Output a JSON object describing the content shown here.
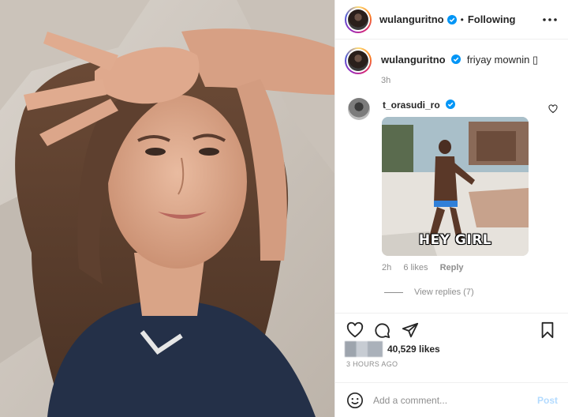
{
  "post": {
    "author": "wulanguritno",
    "follow_status": "Following",
    "dot": "•"
  },
  "caption": {
    "username": "wulanguritno",
    "text": "friyay mownin ▯",
    "time": "3h"
  },
  "comment": {
    "username": "t_orasudi_ro",
    "gif_text": "HEY GIRL",
    "time": "2h",
    "likes": "6 likes",
    "reply_label": "Reply",
    "view_replies": "View replies (7)"
  },
  "stats": {
    "likes": "40,529 likes",
    "posted_ago": "3 HOURS AGO"
  },
  "add_comment": {
    "placeholder": "Add a comment...",
    "post_label": "Post"
  },
  "colors": {
    "verified": "#0095f6",
    "post_button_disabled": "#b3dbff",
    "muted_text": "#8e8e8e"
  },
  "icons": [
    "more-options-icon",
    "verified-icon",
    "heart-icon",
    "comment-icon",
    "share-icon",
    "bookmark-icon",
    "emoji-icon"
  ]
}
